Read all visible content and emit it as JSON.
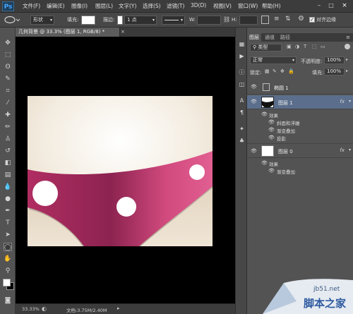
{
  "app": {
    "logo": "Ps"
  },
  "menu": [
    "文件(F)",
    "编辑(E)",
    "图像(I)",
    "图层(L)",
    "文字(Y)",
    "选择(S)",
    "滤镜(T)",
    "3D(D)",
    "视图(V)",
    "窗口(W)",
    "帮助(H)"
  ],
  "options_bar": {
    "shape_mode": "形状",
    "fill_label": "填充:",
    "stroke_label": "描边:",
    "stroke_width": "1 点",
    "w_label": "W:",
    "h_label": "H:",
    "align_edges": "对齐边缘"
  },
  "document": {
    "tab_label": "几何背景 @ 33.3% (图层 1, RGB/8) *",
    "close": "×"
  },
  "status": {
    "zoom": "33.33%",
    "doc_info": "文档:3.75M/2.40M"
  },
  "layers_panel": {
    "tabs": [
      "图层",
      "通道",
      "路径"
    ],
    "filter_kind": "类型",
    "blend_mode": "正常",
    "opacity_label": "不透明度:",
    "opacity_value": "100%",
    "lock_label": "锁定:",
    "fill_label": "填充:",
    "fill_value": "100%",
    "layers": [
      {
        "name": "椭圆 1",
        "visible": true,
        "selected": false,
        "fx": ""
      },
      {
        "name": "图层 1",
        "visible": true,
        "selected": true,
        "fx": "fx",
        "effects_label": "效果",
        "effects": [
          "斜面和浮雕",
          "渐变叠加",
          "投影"
        ]
      },
      {
        "name": "图层 0",
        "visible": true,
        "selected": false,
        "fx": "fx",
        "effects_label": "效果",
        "effects": [
          "渐变叠加"
        ]
      }
    ]
  },
  "watermark": {
    "site": "jb51.net",
    "text": "脚本之家"
  },
  "colors": {
    "accent_pink": "#d24a7e",
    "cream": "#eee3d2",
    "selected_layer": "#5b6f8c"
  }
}
